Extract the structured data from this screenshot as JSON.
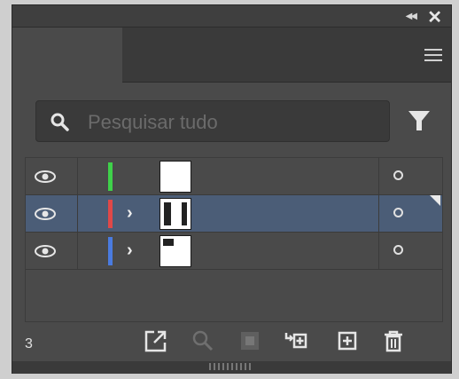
{
  "window": {
    "collapse_icon": "double-chevron-icon",
    "close_icon": "close-icon",
    "close_glyph": "✕"
  },
  "panel": {
    "menu_icon": "hamburger-menu-icon"
  },
  "search": {
    "placeholder": "Pesquisar tudo",
    "value": "",
    "filter_icon": "filter-icon"
  },
  "layers": {
    "rows": [
      {
        "color": "#3fd14a",
        "expandable": false,
        "selected": false,
        "visible": true
      },
      {
        "color": "#e04848",
        "expandable": true,
        "selected": true,
        "visible": true
      },
      {
        "color": "#4a7be0",
        "expandable": true,
        "selected": false,
        "visible": true
      }
    ],
    "chevron": "›"
  },
  "footer": {
    "count": "3",
    "tools": [
      "export-icon",
      "locate-icon",
      "mask-icon",
      "move-to-new-layer-icon",
      "new-layer-icon",
      "trash-icon"
    ]
  },
  "colors": {
    "panel": "#4a4a4a",
    "selected_row": "#4b5d77"
  }
}
